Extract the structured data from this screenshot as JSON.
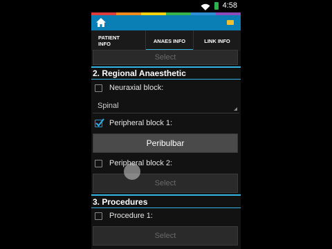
{
  "status_bar": {
    "time": "4:58"
  },
  "brand_colors": [
    "#e13c3c",
    "#f08a1c",
    "#f5d20f",
    "#38b54a",
    "#2f8fd3",
    "#8c4bb8"
  ],
  "tabs": [
    {
      "label": "PATIENT INFO",
      "active": false
    },
    {
      "label": "ANAES INFO",
      "active": true
    },
    {
      "label": "LINK INFO",
      "active": false
    }
  ],
  "top_select": {
    "label": "Select"
  },
  "section_regional": {
    "title": "2. Regional Anaesthetic"
  },
  "neuraxial": {
    "label": "Neuraxial block:",
    "checked": false,
    "spinner_value": "Spinal"
  },
  "peripheral1": {
    "label": "Peripheral block 1:",
    "checked": true,
    "value": "Peribulbar"
  },
  "peripheral2": {
    "label": "Peripheral block 2:",
    "checked": false,
    "button": "Select"
  },
  "section_procedures": {
    "title": "3. Procedures"
  },
  "procedure1": {
    "label": "Procedure 1:",
    "checked": false,
    "button": "Select"
  }
}
